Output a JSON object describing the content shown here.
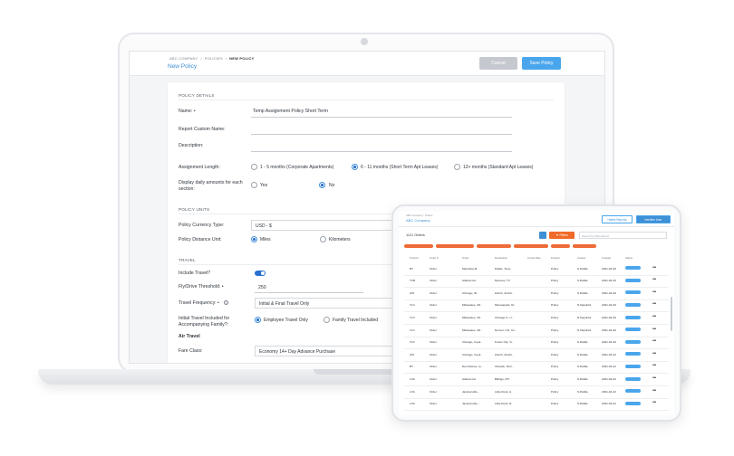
{
  "laptop": {
    "breadcrumb": [
      "ABC COMPANY",
      "POLICIES",
      "NEW POLICY"
    ],
    "page_title": "New Policy",
    "cancel_label": "Cancel",
    "save_label": "Save Policy",
    "policy_details": {
      "section_title": "POLICY DETAILS",
      "name_label": "Name: •",
      "name_value": "Temp Assignment Policy Short Term",
      "report_custom_name_label": "Report Custom Name:",
      "description_label": "Description:",
      "assignment_length_label": "Assignment Length:",
      "assignment_options": [
        "1 - 5 months (Corporate Apartments)",
        "6 - 11 months (Short Term Apt Leases)",
        "12+ months (Standard Apt Leases)"
      ],
      "assignment_selected_index": 1,
      "display_daily_label": "Display daily amounts for each section:",
      "display_daily_options": [
        "Yes",
        "No"
      ],
      "display_daily_selected_index": 1
    },
    "policy_units": {
      "section_title": "POLICY UNITS",
      "currency_label": "Policy Currency Type:",
      "currency_value": "USD - $",
      "distance_label": "Policy Distance Unit:",
      "distance_options": [
        "Miles",
        "Kilometers"
      ],
      "distance_selected_index": 0
    },
    "travel": {
      "section_title": "TRAVEL",
      "include_travel_label": "Include Travel?",
      "include_travel_on": true,
      "threshold_label": "Fly/Drive Threshold: •",
      "threshold_value": "250",
      "frequency_label": "Travel Frequency: •",
      "frequency_value": "Initial & Final Travel Only",
      "initial_travel_label": "Initial Travel Included for Accompanying Family?:",
      "initial_travel_options": [
        "Employee Travel Only",
        "Family Travel Included"
      ],
      "initial_travel_selected_index": 0,
      "air_travel_label": "Air Travel",
      "fare_class_label": "Fare Class:",
      "fare_class_value": "Economy 14+ Day Advance Purchase"
    }
  },
  "tablet": {
    "breadcrumb": "ABC Company  /  Orders",
    "title": "ABC Company",
    "header_buttons": [
      "Hotels Reports",
      "Interline Uxer"
    ],
    "orders_count": "1121 Orders",
    "filters_label": "Filters",
    "search_placeholder": "Search by Plans/Items",
    "columns": [
      "Product",
      "Order #",
      "Origin",
      "Destination",
      "Arrival Date",
      "Product",
      "Creator",
      "Created",
      "Status"
    ],
    "rows": [
      [
        "BT",
        "Order",
        "Manitoba M..",
        "Dallas, Texa..",
        "",
        "Policy",
        "S.Riddle",
        "2021-04-29"
      ],
      [
        "TXR",
        "Order",
        "Atlanta GA",
        "Moscow, TX",
        "",
        "Policy",
        "S.Riddle",
        "2021-04-29"
      ],
      [
        "AHI",
        "Order",
        "Chicago, Illi..",
        "Zurich, Zurich..",
        "",
        "Policy",
        "S.Riddle",
        "2021-04-29"
      ],
      [
        "TLC",
        "Order",
        "Milwaukee, WI..",
        "Minneapolis, M..",
        "",
        "Policy",
        "N.Napolitni",
        "2021-04-29"
      ],
      [
        "TLC",
        "Order",
        "Milwaukee, WI..",
        "Chicago IL, U..",
        "",
        "Policy",
        "N.Napolitni",
        "2021-04-29"
      ],
      [
        "TLC",
        "Order",
        "Milwaukee, WI..",
        "Denver, CO, Un..",
        "",
        "Policy",
        "N.Napolitni",
        "2021-04-29"
      ],
      [
        "TLC",
        "Order",
        "Chicago, Cook..",
        "Foster City, S..",
        "",
        "Policy",
        "S.Riddle",
        "2021-04-29"
      ],
      [
        "AHI",
        "Order",
        "Chicago, Cook..",
        "Zurich, Zurich..",
        "",
        "Policy",
        "S.Riddle",
        "2021-04-22"
      ],
      [
        "BT",
        "Order",
        "Des Moines, Io..",
        "Orlando, Flori..",
        "",
        "Policy",
        "S.Riddle",
        "2021-04-22"
      ],
      [
        "LXA",
        "Order",
        "Atlanta GA",
        "Billings, MT..",
        "",
        "Policy",
        "S.Riddle",
        "2021-04-22"
      ],
      [
        "LXA",
        "Order",
        "Jacksonville, ..",
        "Little Rock, A..",
        "",
        "Policy",
        "S.Riddle",
        "2021-04-22"
      ],
      [
        "LXA",
        "Order",
        "Jacksonville, ..",
        "Little Rock, R..",
        "",
        "Policy",
        "S.Riddle",
        "2021-04-22"
      ]
    ]
  },
  "colors": {
    "accent": "#3d8fd6",
    "filter": "#f06a2a",
    "badge": "#4aa6ec"
  }
}
